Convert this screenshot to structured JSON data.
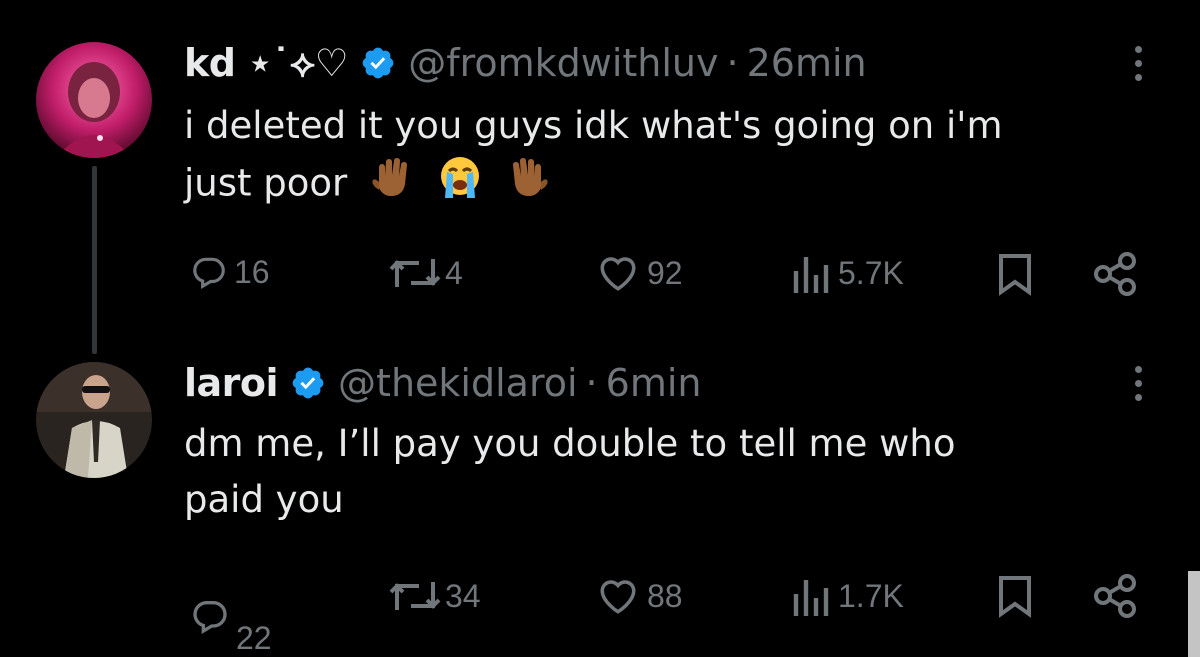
{
  "tweets": [
    {
      "author": {
        "display_name": "kd ⋆˙⟡♡",
        "handle": "@fromkdwithluv",
        "verified": true
      },
      "separator": "·",
      "time": "26min",
      "text_line1": "i deleted it you guys idk what's going on i'm",
      "text_line2": "just poor",
      "emojis": [
        "raised-hand-icon",
        "loudly-crying-face-icon",
        "raised-hand-icon"
      ],
      "stats": {
        "replies": "16",
        "reposts": "4",
        "likes": "92",
        "views": "5.7K"
      }
    },
    {
      "author": {
        "display_name": "laroi",
        "handle": "@thekidlaroi",
        "verified": true
      },
      "separator": "·",
      "time": "6min",
      "text_line1": "dm me, I’ll pay you double to tell me who",
      "text_line2": "paid you",
      "stats": {
        "replies": "22",
        "reposts": "34",
        "likes": "88",
        "views": "1.7K"
      }
    }
  ],
  "colors": {
    "background": "#000000",
    "text": "#e7e9ea",
    "secondary": "#71767b",
    "verified": "#1d9bf0"
  }
}
